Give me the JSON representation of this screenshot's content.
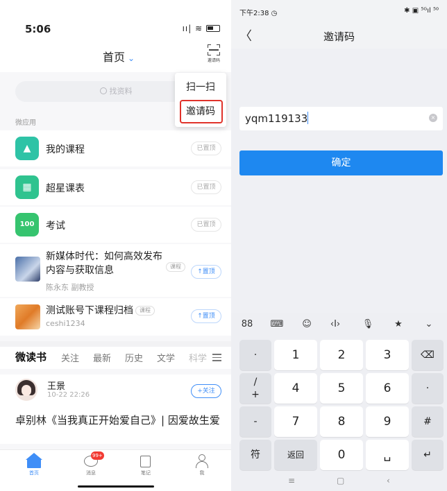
{
  "left": {
    "status": {
      "time": "5:06",
      "icons": "ıı| ≋"
    },
    "nav": {
      "title": "首页",
      "chevron": "⌄",
      "scan_label": "邀请码"
    },
    "search": {
      "placeholder": "找资料"
    },
    "popup": {
      "scan": "扫一扫",
      "invite": "邀请码",
      "highlight_color": "#e0322a"
    },
    "section_label": "微应用",
    "apps": [
      {
        "label": "我的课程",
        "icon": "graduation-cap-icon",
        "color": "#2ec3a6",
        "glyph": "🎓",
        "tag": "已置顶"
      },
      {
        "label": "超星课表",
        "icon": "calendar-icon",
        "color": "#2fc38f",
        "glyph": "▦",
        "tag": "已置顶"
      },
      {
        "label": "考试",
        "icon": "exam-icon",
        "color": "#36c46f",
        "glyph": "100",
        "tag": "已置顶"
      }
    ],
    "courses": [
      {
        "title_line1": "新媒体时代：如何高效发布",
        "title_line2": "内容与获取信息",
        "type": "课程",
        "sub": "陈永东  副教授",
        "action": "↑置顶"
      },
      {
        "title_line1": "测试账号下课程归档",
        "type": "课程",
        "sub": "ceshi1234",
        "action": "↑置顶"
      }
    ],
    "tabs": [
      "微读书",
      "关注",
      "最新",
      "历史",
      "文学",
      "科学"
    ],
    "feed": {
      "name": "王景",
      "time": "10-22 22:26",
      "follow": "+关注",
      "text": "卓别林《当我真正开始爱自己》| 因爱故生爱"
    },
    "bottom_nav": [
      {
        "label": "首页",
        "active": true
      },
      {
        "label": "消息",
        "badge": "99+"
      },
      {
        "label": "笔记"
      },
      {
        "label": "我"
      }
    ],
    "accent": "#3f8ef7"
  },
  "right": {
    "status": {
      "time": "下午2:38 ◷",
      "icons": "✱ ▣ ⁵ᴳıl ⁵⁰"
    },
    "nav": {
      "back": "〈",
      "title": "邀请码"
    },
    "input": {
      "value": "yqm119133",
      "clear": "×"
    },
    "confirm": "确定",
    "kb_tools": [
      "88",
      "⌨",
      "☺",
      "‹I›",
      "🎙",
      "★",
      "⌄"
    ],
    "keys": {
      "row1": [
        "·",
        "1",
        "2",
        "3",
        "⌫"
      ],
      "row2": [
        "/",
        "4",
        "5",
        "6",
        "·"
      ],
      "row2_extra": "+",
      "row3": [
        "-",
        "7",
        "8",
        "9",
        "#"
      ],
      "row4": [
        "符",
        "返回",
        "0",
        "␣",
        "↵"
      ]
    },
    "nav_keys": [
      "≡",
      "▢",
      "‹"
    ],
    "button_color": "#1e88f0"
  }
}
